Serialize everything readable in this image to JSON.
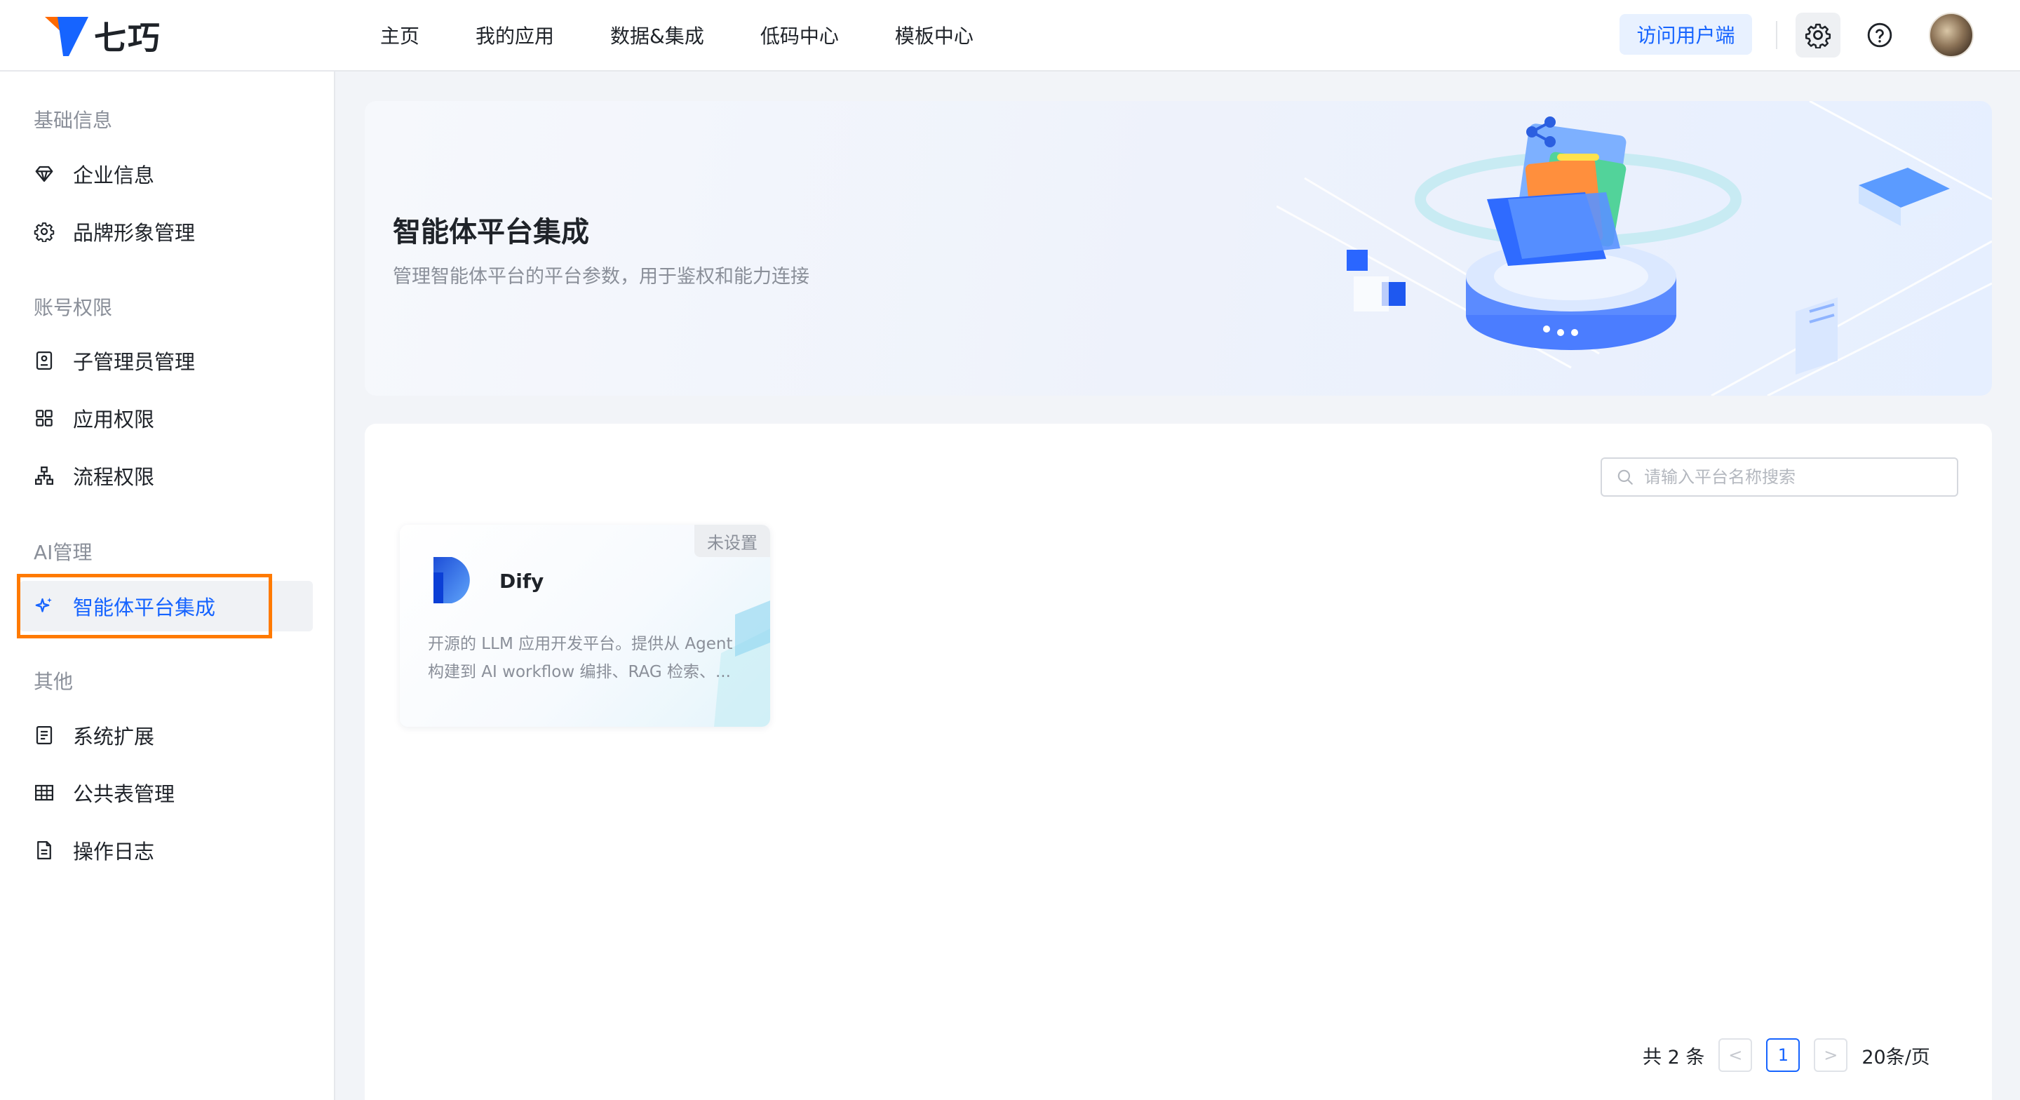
{
  "brand": {
    "name": "七巧",
    "accent_color": "#1664ff",
    "logo_colors": [
      "#ff6a00",
      "#1664ff"
    ]
  },
  "nav": {
    "items": [
      "主页",
      "我的应用",
      "数据&集成",
      "低码中心",
      "模板中心"
    ],
    "visit_user_button": "访问用户端",
    "settings_icon": "gear-icon",
    "help_icon": "question-circle-icon"
  },
  "sidebar": {
    "groups": [
      {
        "title": "基础信息",
        "items": [
          {
            "label": "企业信息",
            "icon": "diamond-icon"
          },
          {
            "label": "品牌形象管理",
            "icon": "gear-icon"
          }
        ]
      },
      {
        "title": "账号权限",
        "items": [
          {
            "label": "子管理员管理",
            "icon": "id-card-icon"
          },
          {
            "label": "应用权限",
            "icon": "grid-icon"
          },
          {
            "label": "流程权限",
            "icon": "hierarchy-icon"
          }
        ]
      },
      {
        "title": "AI管理",
        "items": [
          {
            "label": "智能体平台集成",
            "icon": "sparkle-icon",
            "active": true
          }
        ]
      },
      {
        "title": "其他",
        "items": [
          {
            "label": "系统扩展",
            "icon": "doc-list-icon"
          },
          {
            "label": "公共表管理",
            "icon": "table-icon"
          },
          {
            "label": "操作日志",
            "icon": "file-icon"
          }
        ]
      }
    ]
  },
  "banner": {
    "title": "智能体平台集成",
    "subtitle": "管理智能体平台的平台参数，用于鉴权和能力连接"
  },
  "search": {
    "placeholder": "请输入平台名称搜索"
  },
  "cards": [
    {
      "name": "Dify",
      "status": "未设置",
      "desc_line1": "开源的 LLM 应用开发平台。提供从 Agent",
      "desc_line2": "构建到 AI workflow 编排、RAG 检索、..."
    }
  ],
  "pagination": {
    "total_text": "共 2 条",
    "prev": "<",
    "current_page": "1",
    "next": ">",
    "page_size": "20条/页"
  }
}
